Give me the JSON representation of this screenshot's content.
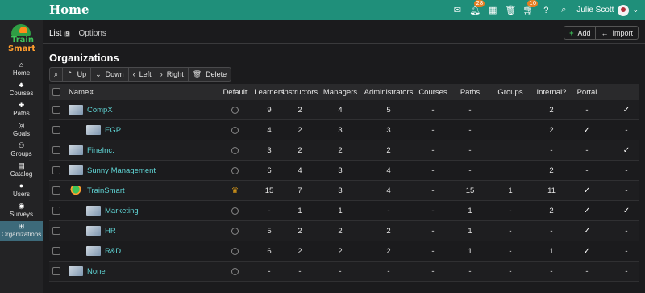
{
  "header": {
    "title": "Home",
    "user_name": "Julie Scott",
    "badges": {
      "notifications": "28",
      "cart": "10"
    },
    "icons": [
      "mail-icon",
      "bell-icon",
      "calendar-icon",
      "trash-icon",
      "cart-icon",
      "help-icon",
      "search-icon"
    ]
  },
  "sidebar": {
    "logo_line1": "Train",
    "logo_line2": "Smart",
    "items": [
      {
        "label": "Home",
        "icon": "home-icon"
      },
      {
        "label": "Courses",
        "icon": "courses-icon"
      },
      {
        "label": "Paths",
        "icon": "paths-icon"
      },
      {
        "label": "Goals",
        "icon": "goals-icon"
      },
      {
        "label": "Groups",
        "icon": "groups-icon"
      },
      {
        "label": "Catalog",
        "icon": "catalog-icon"
      },
      {
        "label": "Users",
        "icon": "users-icon"
      },
      {
        "label": "Surveys",
        "icon": "surveys-icon"
      },
      {
        "label": "Organizations",
        "icon": "organizations-icon",
        "active": true
      }
    ]
  },
  "tabs": {
    "list_label": "List",
    "list_count": "9",
    "options_label": "Options"
  },
  "actions": {
    "add_label": "Add",
    "import_label": "Import"
  },
  "page_title": "Organizations",
  "toolbar": {
    "up": "Up",
    "down": "Down",
    "left": "Left",
    "right": "Right",
    "delete": "Delete"
  },
  "columns": [
    "Name",
    "Default",
    "Learners",
    "Instructors",
    "Managers",
    "Administrators",
    "Courses",
    "Paths",
    "Groups",
    "Internal?",
    "Portal"
  ],
  "rows": [
    {
      "name": "CompX",
      "indent": 0,
      "thumb": "photo",
      "default": "radio",
      "learners": "9",
      "instructors": "2",
      "managers": "4",
      "administrators": "5",
      "courses": "-",
      "paths": "-",
      "groups": "2",
      "internal": "-",
      "portal": "check"
    },
    {
      "name": "EGP",
      "indent": 1,
      "thumb": "photo",
      "default": "radio",
      "learners": "4",
      "instructors": "2",
      "managers": "3",
      "administrators": "3",
      "courses": "-",
      "paths": "-",
      "groups": "2",
      "internal": "check",
      "portal": "-"
    },
    {
      "name": "FineInc.",
      "indent": 0,
      "thumb": "photo",
      "default": "radio",
      "learners": "3",
      "instructors": "2",
      "managers": "2",
      "administrators": "2",
      "courses": "-",
      "paths": "-",
      "groups": "-",
      "internal": "-",
      "portal": "check"
    },
    {
      "name": "Sunny Management",
      "indent": 0,
      "thumb": "photo",
      "default": "radio",
      "learners": "6",
      "instructors": "4",
      "managers": "3",
      "administrators": "4",
      "courses": "-",
      "paths": "-",
      "groups": "2",
      "internal": "-",
      "portal": "-"
    },
    {
      "name": "TrainSmart",
      "indent": 0,
      "thumb": "logo",
      "default": "crown",
      "learners": "15",
      "instructors": "7",
      "managers": "3",
      "administrators": "4",
      "courses": "-",
      "paths": "15",
      "groups": "1",
      "internal_groups": "11",
      "internal": "check",
      "portal": "-"
    },
    {
      "name": "Marketing",
      "indent": 1,
      "thumb": "photo",
      "default": "radio",
      "learners": "-",
      "instructors": "1",
      "managers": "1",
      "administrators": "-",
      "courses": "-",
      "paths": "1",
      "groups": "-",
      "internal_groups": "2",
      "internal": "check",
      "portal": "check"
    },
    {
      "name": "HR",
      "indent": 1,
      "thumb": "photo",
      "default": "radio",
      "learners": "5",
      "instructors": "2",
      "managers": "2",
      "administrators": "2",
      "courses": "-",
      "paths": "1",
      "groups": "-",
      "internal_groups": "-",
      "internal": "check",
      "portal": "-"
    },
    {
      "name": "R&D",
      "indent": 1,
      "thumb": "photo",
      "default": "radio",
      "learners": "6",
      "instructors": "2",
      "managers": "2",
      "administrators": "2",
      "courses": "-",
      "paths": "1",
      "groups": "-",
      "internal_groups": "1",
      "internal": "check",
      "portal": "-"
    },
    {
      "name": "None",
      "indent": 0,
      "thumb": "photo",
      "default": "radio",
      "learners": "-",
      "instructors": "-",
      "managers": "-",
      "administrators": "-",
      "courses": "-",
      "paths": "-",
      "groups": "-",
      "internal_groups": "-",
      "internal": "-",
      "portal": "-"
    }
  ],
  "colors": {
    "topbar": "#1f8f7a",
    "accent_link": "#5fd3d3",
    "badge": "#e67e22",
    "active_nav": "#3d6a7a"
  }
}
